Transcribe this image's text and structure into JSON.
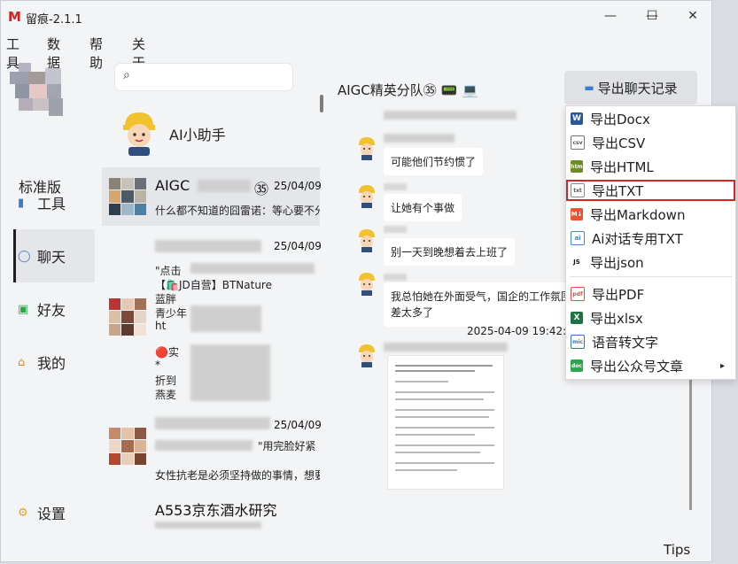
{
  "window": {
    "app_icon": "M",
    "title": "留痕-2.1.1",
    "minimize": "—",
    "maximize": "☐",
    "close": "✕"
  },
  "menu": [
    "工具",
    "数据",
    "帮助",
    "关于"
  ],
  "sidebar": {
    "edition": "标准版",
    "items": [
      {
        "label": "工具",
        "icon": "tools-icon"
      },
      {
        "label": "聊天",
        "icon": "chat-icon"
      },
      {
        "label": "好友",
        "icon": "contacts-icon"
      },
      {
        "label": "我的",
        "icon": "home-icon"
      },
      {
        "label": "设置",
        "icon": "gear-icon"
      }
    ]
  },
  "conversations": {
    "assistant_label": "AI小助手",
    "items": [
      {
        "name": "AIGC",
        "name_suffix": "㉟",
        "date": "25/04/09",
        "preview": "什么都不知道的囧雷诺：等心要不分享"
      },
      {
        "name": "",
        "date": "25/04/09",
        "lines": [
          "\"点击",
          "【🛍️JD自营】BTNature",
          "蓝胖",
          "青少年",
          "ht",
          "🔴实",
          "*",
          "折到",
          "燕麦"
        ]
      },
      {
        "name": "",
        "date": "25/04/09",
        "preview_name": "\"用完脸好紧",
        "preview": "女性抗老是必须坚持做的事情，想要脸"
      },
      {
        "name": "A553京东酒水研究",
        "date": ""
      }
    ]
  },
  "chat": {
    "title": "AIGC精英分队㉟",
    "title_emoji": "📟 💻",
    "export_button": "导出聊天记录",
    "export_icon": "folder-icon",
    "messages": [
      {
        "text": "可能他们节约惯了"
      },
      {
        "text": "让她有个事做"
      },
      {
        "text": "别一天到晚想着去上班了"
      },
      {
        "text": "我总怕她在外面受气，国企的工作氛围",
        "text2": "差太多了"
      }
    ],
    "timestamp": "2025-04-09 19:42:02",
    "tips": "Tips"
  },
  "export_menu": {
    "items": [
      {
        "label": "导出Docx",
        "icon": "W",
        "color": "#2b579a"
      },
      {
        "label": "导出CSV",
        "icon": "csv",
        "color": "#6a6a6a"
      },
      {
        "label": "导出HTML",
        "icon": "htm",
        "color": "#6b8e23"
      },
      {
        "label": "导出TXT",
        "icon": "txt",
        "color": "#7a7a7a",
        "highlighted": true
      },
      {
        "label": "导出Markdown",
        "icon": "M↓",
        "color": "#e8552e"
      },
      {
        "label": "Ai对话专用TXT",
        "icon": "ai",
        "color": "#3a8bd8"
      },
      {
        "label": "导出json",
        "icon": "JS",
        "color": "#111111"
      },
      {
        "label": "导出PDF",
        "icon": "pdf",
        "color": "#e44b3a"
      },
      {
        "label": "导出xlsx",
        "icon": "X",
        "color": "#1f7244"
      },
      {
        "label": "语音转文字",
        "icon": "mic",
        "color": "#2e6fd8"
      },
      {
        "label": "导出公众号文章",
        "icon": "doc",
        "color": "#2aa84a",
        "has_submenu": true
      }
    ],
    "submenu_arrow": "▸"
  }
}
